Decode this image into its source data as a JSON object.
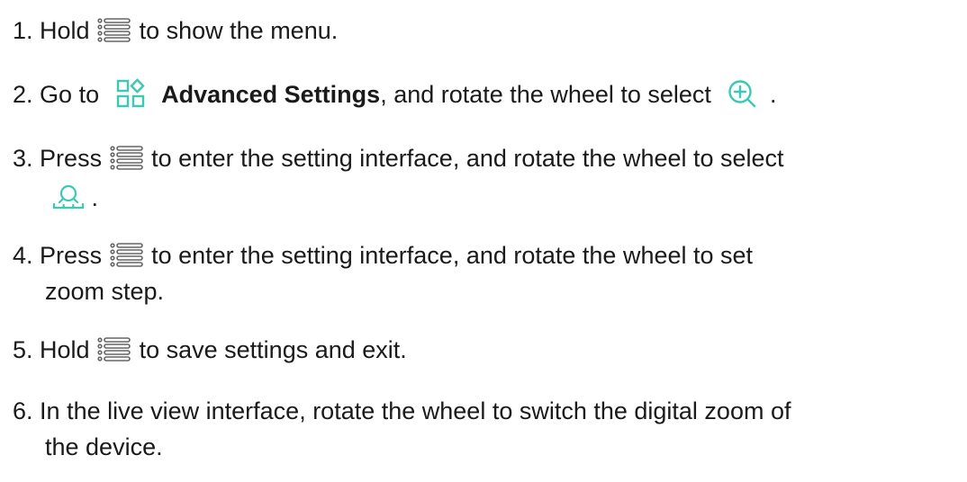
{
  "colors": {
    "text": "#1a1a1a",
    "icon_gray": "#666666",
    "icon_teal": "#3cc9b4"
  },
  "steps": [
    {
      "num": "1.",
      "t1": "Hold",
      "icon1": "menu-list-icon",
      "t2": "to show the menu."
    },
    {
      "num": "2.",
      "t1": "Go to",
      "icon1": "advanced-settings-icon",
      "bold": "Advanced Settings",
      "t2": ", and rotate the wheel to select",
      "icon2": "zoom-in-icon",
      "t3": "."
    },
    {
      "num": "3.",
      "t1": "Press",
      "icon1": "menu-list-icon",
      "t2": "to enter the setting interface, and rotate the wheel to select",
      "icon2": "zoom-step-icon",
      "t3": "."
    },
    {
      "num": "4.",
      "t1": "Press",
      "icon1": "menu-list-icon",
      "t2": "to enter the setting interface, and rotate the wheel to set",
      "t3": "zoom step."
    },
    {
      "num": "5.",
      "t1": "Hold",
      "icon1": "menu-list-icon",
      "t2": "to save settings and exit."
    },
    {
      "num": "6.",
      "t1": "In the live view interface, rotate the wheel to switch the digital zoom of",
      "t2": "the device."
    }
  ]
}
